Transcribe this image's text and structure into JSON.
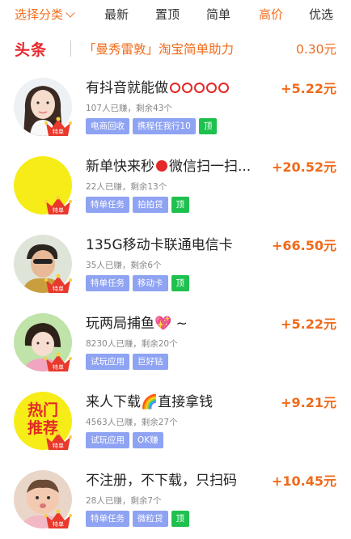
{
  "tabs": [
    {
      "label": "选择分类",
      "state": "category"
    },
    {
      "label": "最新",
      "state": "normal"
    },
    {
      "label": "置顶",
      "state": "normal"
    },
    {
      "label": "简单",
      "state": "normal"
    },
    {
      "label": "高价",
      "state": "active"
    },
    {
      "label": "优选",
      "state": "normal"
    }
  ],
  "headline": {
    "tag": "头条",
    "text": "「曼秀雷敦」淘宝简单助力",
    "price": "0.30元"
  },
  "colors": {
    "accent": "#f36f1f",
    "headline_red": "#e8262b",
    "tag_blue": "#8fa3f3",
    "tag_green": "#1fc14e"
  },
  "tasks": [
    {
      "title": "有抖音就能做",
      "title_suffix": "circles",
      "price": "+5.22元",
      "meta": "107人已赚，剩余43个",
      "tags": [
        "电商回收",
        "携程任我行10"
      ],
      "top_label": "顶",
      "avatar": "woman-portrait"
    },
    {
      "title": "新单快来秒",
      "title_after": "微信扫一扫...",
      "price": "+20.52元",
      "meta": "22人已赚，剩余13个",
      "tags": [
        "特单任务",
        "拍拍贷"
      ],
      "top_label": "顶",
      "avatar": "yellow-circle"
    },
    {
      "title": "135G移动卡联通电信卡",
      "price": "+66.50元",
      "meta": "35人已赚，剩余6个",
      "tags": [
        "特单任务",
        "移动卡"
      ],
      "top_label": "顶",
      "avatar": "man-portrait"
    },
    {
      "title": "玩两局捕鱼💖 ~",
      "price": "+5.22元",
      "meta": "8230人已赚，剩余20个",
      "tags": [
        "试玩应用",
        "巨好钻"
      ],
      "top_label": "",
      "avatar": "girl-portrait"
    },
    {
      "title": "来人下载🌈直接拿钱",
      "price": "+9.21元",
      "meta": "4563人已赚，剩余27个",
      "tags": [
        "试玩应用",
        "OK赚"
      ],
      "top_label": "",
      "avatar": "hot-recommend",
      "avatar_text": [
        "热门",
        "推荐"
      ]
    },
    {
      "title": "不注册，不下载，只扫码",
      "price": "+10.45元",
      "meta": "28人已赚，剩余7个",
      "tags": [
        "特单任务",
        "微粒贷"
      ],
      "top_label": "顶",
      "avatar": "baby-portrait"
    }
  ]
}
